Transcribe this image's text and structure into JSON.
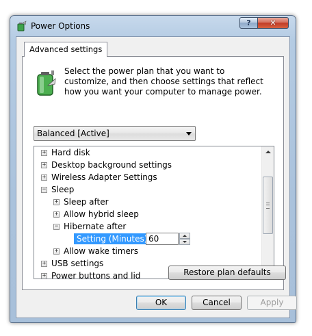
{
  "window": {
    "title": "Power Options",
    "help_label": "?",
    "close_label": "✕"
  },
  "tab": {
    "label": "Advanced settings"
  },
  "intro": {
    "text": "Select the power plan that you want to customize, and then choose settings that reflect how you want your computer to manage power."
  },
  "plan_select": {
    "value": "Balanced [Active]"
  },
  "tree": {
    "items": [
      {
        "label": "Hard disk",
        "expander": "+"
      },
      {
        "label": "Desktop background settings",
        "expander": "+"
      },
      {
        "label": "Wireless Adapter Settings",
        "expander": "+"
      },
      {
        "label": "Sleep",
        "expander": "−"
      },
      {
        "label": "Sleep after",
        "expander": "+"
      },
      {
        "label": "Allow hybrid sleep",
        "expander": "+"
      },
      {
        "label": "Hibernate after",
        "expander": "−"
      },
      {
        "label": "Setting (Minutes):",
        "value": "60"
      },
      {
        "label": "Allow wake timers",
        "expander": "+"
      },
      {
        "label": "USB settings",
        "expander": "+"
      },
      {
        "label": "Power buttons and lid",
        "expander": "+"
      }
    ]
  },
  "buttons": {
    "restore": "Restore plan defaults",
    "ok": "OK",
    "cancel": "Cancel",
    "apply": "Apply"
  },
  "icons": {
    "app": "power-options-icon",
    "battery": "battery-icon"
  }
}
